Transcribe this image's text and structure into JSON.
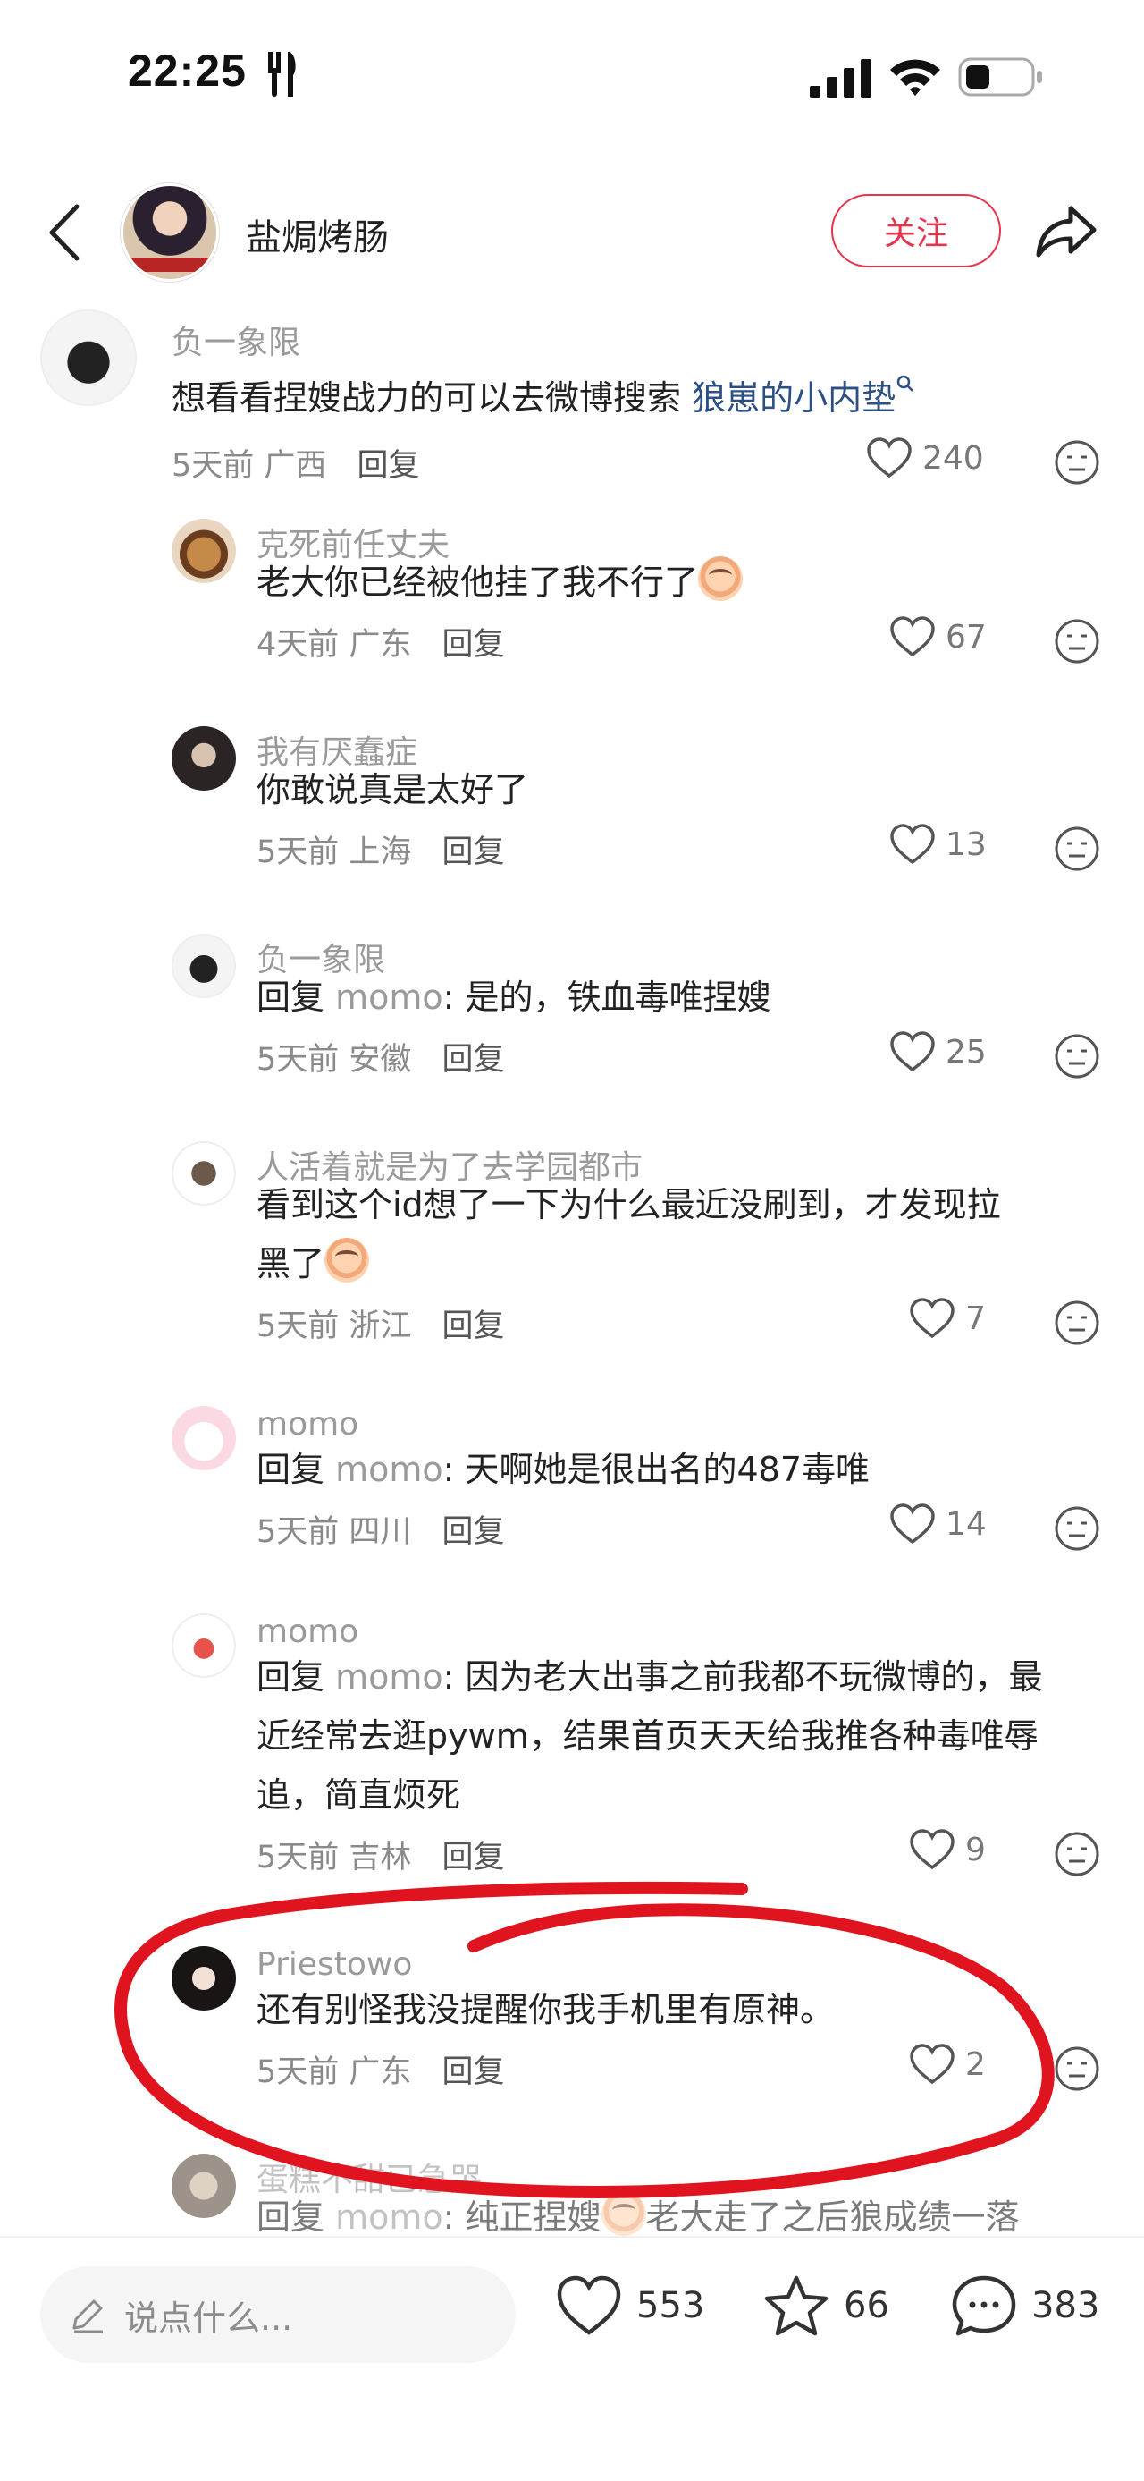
{
  "status": {
    "time": "22:25"
  },
  "header": {
    "username": "盐焗烤肠",
    "follow_label": "关注"
  },
  "comments": [
    {
      "username": "负一象限",
      "content": "想看看捏嫂战力的可以去微博搜索 ",
      "link": "狼崽的小内垫",
      "time": "5天前",
      "location": "广西",
      "reply_label": "回复",
      "likes": "240"
    },
    {
      "username": "克死前任丈夫",
      "content": "老大你已经被他挂了我不行了",
      "time": "4天前",
      "location": "广东",
      "reply_label": "回复",
      "likes": "67"
    },
    {
      "username": "我有厌蠢症",
      "content": "你敢说真是太好了",
      "time": "5天前",
      "location": "上海",
      "reply_label": "回复",
      "likes": "13"
    },
    {
      "username": "负一象限",
      "reply_prefix": "回复 ",
      "reply_to": "momo",
      "content": ": 是的，铁血毒唯捏嫂",
      "time": "5天前",
      "location": "安徽",
      "reply_label": "回复",
      "likes": "25"
    },
    {
      "username": "人活着就是为了去学园都市",
      "content_line1": "看到这个id想了一下为什么最近没刷到，才发现拉",
      "content_line2": "黑了",
      "time": "5天前",
      "location": "浙江",
      "reply_label": "回复",
      "likes": "7"
    },
    {
      "username": "momo",
      "reply_prefix": "回复 ",
      "reply_to": "momo",
      "content": ": 天啊她是很出名的487毒唯",
      "time": "5天前",
      "location": "四川",
      "reply_label": "回复",
      "likes": "14"
    },
    {
      "username": "momo",
      "reply_prefix": "回复 ",
      "reply_to": "momo",
      "content_line1": ": 因为老大出事之前我都不玩微博的，最",
      "content_line2": "近经常去逛pywm，结果首页天天给我推各种毒唯辱",
      "content_line3": "追，简直烦死",
      "time": "5天前",
      "location": "吉林",
      "reply_label": "回复",
      "likes": "9"
    },
    {
      "username": "Priestowo",
      "content": "还有别怪我没提醒你我手机里有原神。",
      "time": "5天前",
      "location": "广东",
      "reply_label": "回复",
      "likes": "2"
    },
    {
      "username": "蛋糕不甜已急哭",
      "reply_prefix": "回复 ",
      "reply_to": "momo",
      "content": ": 纯正捏嫂",
      "content_tail": "老大走了之后狼成绩一落"
    }
  ],
  "bottom": {
    "placeholder": "说点什么...",
    "likes": "553",
    "favorites": "66",
    "comments": "383"
  },
  "colors": {
    "accent": "#e8334d",
    "link": "#2c4f84",
    "annotation": "#e0141e"
  }
}
